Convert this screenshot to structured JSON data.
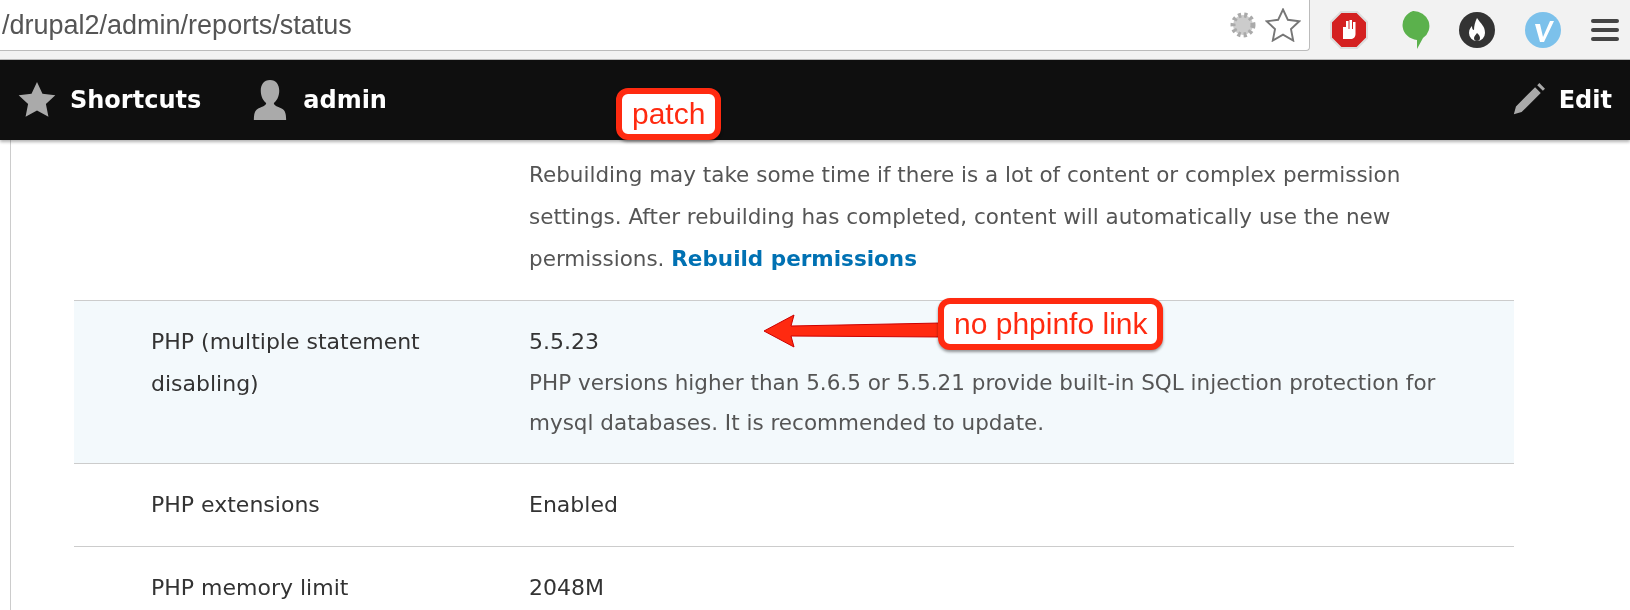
{
  "browser": {
    "address": "/drupal2/admin/reports/status"
  },
  "toolbar": {
    "items": [
      {
        "label": "Shortcuts",
        "kind": "shortcuts"
      },
      {
        "label": "admin",
        "kind": "user"
      }
    ],
    "edit": "Edit"
  },
  "rows": [
    {
      "description": "Rebuilding may take some time if there is a lot of content or complex permission settings. After rebuilding has completed, content will automatically use the new permissions.",
      "link": "Rebuild permissions",
      "highlighted": false
    },
    {
      "label": "PHP (multiple statement disabling)",
      "value": "5.5.23",
      "description": "PHP versions higher than 5.6.5 or 5.5.21 provide built-in SQL injection protection for mysql databases. It is recommended to update.",
      "highlighted": true
    },
    {
      "label": "PHP extensions",
      "value": "Enabled",
      "highlighted": false
    },
    {
      "label": "PHP memory limit",
      "value": "2048M",
      "highlighted": false
    }
  ],
  "annotations": [
    {
      "text": "patch",
      "kind": "label"
    },
    {
      "text": "no phpinfo link",
      "kind": "arrow-label"
    }
  ]
}
